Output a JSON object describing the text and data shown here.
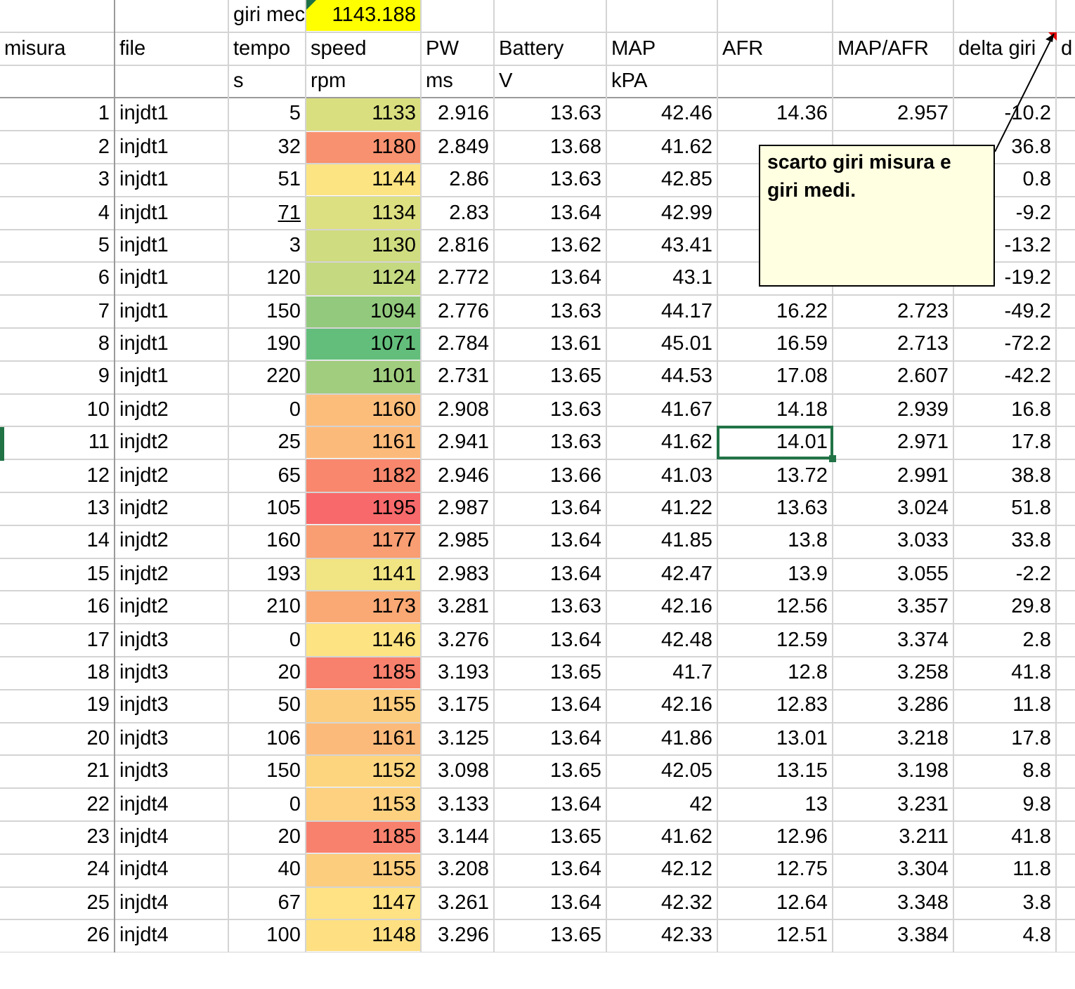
{
  "summary": {
    "label": "giri mec",
    "value": "1143.188"
  },
  "columns": [
    {
      "name": "misura"
    },
    {
      "name": "file"
    },
    {
      "name": "tempo",
      "unit": "s"
    },
    {
      "name": "speed",
      "unit": "rpm"
    },
    {
      "name": "PW",
      "unit": "ms"
    },
    {
      "name": "Battery",
      "unit": "V"
    },
    {
      "name": "MAP",
      "unit": "kPA"
    },
    {
      "name": "AFR"
    },
    {
      "name": "MAP/AFR"
    },
    {
      "name": "delta giri",
      "has_comment": true
    },
    {
      "name": "d"
    }
  ],
  "rows": [
    {
      "misura": "1",
      "file": "injdt1",
      "tempo": "5",
      "tempo_underlined": false,
      "speed": "1133",
      "color": "#d9df7f",
      "pw": "2.916",
      "battery": "13.63",
      "map": "42.46",
      "afr": "14.36",
      "afr_selected": false,
      "map_afr": "2.957",
      "delta": "-10.2"
    },
    {
      "misura": "2",
      "file": "injdt1",
      "tempo": "32",
      "tempo_underlined": false,
      "speed": "1180",
      "color": "#f8916f",
      "pw": "2.849",
      "battery": "13.68",
      "map": "41.62",
      "afr_selected": false,
      "delta": "36.8"
    },
    {
      "misura": "3",
      "file": "injdt1",
      "tempo": "51",
      "tempo_underlined": false,
      "speed": "1144",
      "color": "#fde482",
      "pw": "2.86",
      "battery": "13.63",
      "map": "42.85",
      "afr_selected": false,
      "delta": "0.8"
    },
    {
      "misura": "4",
      "file": "injdt1",
      "tempo": "71",
      "tempo_underlined": true,
      "speed": "1134",
      "color": "#dde081",
      "pw": "2.83",
      "battery": "13.64",
      "map": "42.99",
      "afr_selected": false,
      "delta": "-9.2"
    },
    {
      "misura": "5",
      "file": "injdt1",
      "tempo": "3",
      "tempo_underlined": false,
      "speed": "1130",
      "color": "#d0dc80",
      "pw": "2.816",
      "battery": "13.62",
      "map": "43.41",
      "afr_selected": false,
      "delta": "-13.2"
    },
    {
      "misura": "6",
      "file": "injdt1",
      "tempo": "120",
      "tempo_underlined": false,
      "speed": "1124",
      "color": "#c4d980",
      "pw": "2.772",
      "battery": "13.64",
      "map": "43.1",
      "afr_selected": false,
      "delta": "-19.2"
    },
    {
      "misura": "7",
      "file": "injdt1",
      "tempo": "150",
      "tempo_underlined": false,
      "speed": "1094",
      "color": "#92c97d",
      "pw": "2.776",
      "battery": "13.63",
      "map": "44.17",
      "afr": "16.22",
      "afr_selected": false,
      "map_afr": "2.723",
      "delta": "-49.2"
    },
    {
      "misura": "8",
      "file": "injdt1",
      "tempo": "190",
      "tempo_underlined": false,
      "speed": "1071",
      "color": "#63be7b",
      "pw": "2.784",
      "battery": "13.61",
      "map": "45.01",
      "afr": "16.59",
      "afr_selected": false,
      "map_afr": "2.713",
      "delta": "-72.2"
    },
    {
      "misura": "9",
      "file": "injdt1",
      "tempo": "220",
      "tempo_underlined": false,
      "speed": "1101",
      "color": "#a0cd7e",
      "pw": "2.731",
      "battery": "13.65",
      "map": "44.53",
      "afr": "17.08",
      "afr_selected": false,
      "map_afr": "2.607",
      "delta": "-42.2"
    },
    {
      "misura": "10",
      "file": "injdt2",
      "tempo": "0",
      "tempo_underlined": false,
      "speed": "1160",
      "color": "#fcbd7b",
      "pw": "2.908",
      "battery": "13.63",
      "map": "41.67",
      "afr": "14.18",
      "afr_selected": false,
      "map_afr": "2.939",
      "delta": "16.8"
    },
    {
      "misura": "11",
      "file": "injdt2",
      "tempo": "25",
      "tempo_underlined": false,
      "speed": "1161",
      "color": "#fcba7a",
      "pw": "2.941",
      "battery": "13.63",
      "map": "41.62",
      "afr": "14.01",
      "afr_selected": true,
      "map_afr": "2.971",
      "delta": "17.8"
    },
    {
      "misura": "12",
      "file": "injdt2",
      "tempo": "65",
      "tempo_underlined": false,
      "speed": "1182",
      "color": "#f8876d",
      "pw": "2.946",
      "battery": "13.66",
      "map": "41.03",
      "afr": "13.72",
      "afr_selected": false,
      "map_afr": "2.991",
      "delta": "38.8"
    },
    {
      "misura": "13",
      "file": "injdt2",
      "tempo": "105",
      "tempo_underlined": false,
      "speed": "1195",
      "color": "#f8696b",
      "pw": "2.987",
      "battery": "13.64",
      "map": "41.22",
      "afr": "13.63",
      "afr_selected": false,
      "map_afr": "3.024",
      "delta": "51.8"
    },
    {
      "misura": "14",
      "file": "injdt2",
      "tempo": "160",
      "tempo_underlined": false,
      "speed": "1177",
      "color": "#f99d72",
      "pw": "2.985",
      "battery": "13.64",
      "map": "41.85",
      "afr": "13.8",
      "afr_selected": false,
      "map_afr": "3.033",
      "delta": "33.8"
    },
    {
      "misura": "15",
      "file": "injdt2",
      "tempo": "193",
      "tempo_underlined": false,
      "speed": "1141",
      "color": "#f1e583",
      "pw": "2.983",
      "battery": "13.64",
      "map": "42.47",
      "afr": "13.9",
      "afr_selected": false,
      "map_afr": "3.055",
      "delta": "-2.2"
    },
    {
      "misura": "16",
      "file": "injdt2",
      "tempo": "210",
      "tempo_underlined": false,
      "speed": "1173",
      "color": "#faa874",
      "pw": "3.281",
      "battery": "13.63",
      "map": "42.16",
      "afr": "12.56",
      "afr_selected": false,
      "map_afr": "3.357",
      "delta": "29.8"
    },
    {
      "misura": "17",
      "file": "injdt3",
      "tempo": "0",
      "tempo_underlined": false,
      "speed": "1146",
      "color": "#fee382",
      "pw": "3.276",
      "battery": "13.64",
      "map": "42.48",
      "afr": "12.59",
      "afr_selected": false,
      "map_afr": "3.374",
      "delta": "2.8"
    },
    {
      "misura": "18",
      "file": "injdt3",
      "tempo": "20",
      "tempo_underlined": false,
      "speed": "1185",
      "color": "#f8816d",
      "pw": "3.193",
      "battery": "13.65",
      "map": "41.7",
      "afr": "12.8",
      "afr_selected": false,
      "map_afr": "3.258",
      "delta": "41.8"
    },
    {
      "misura": "19",
      "file": "injdt3",
      "tempo": "50",
      "tempo_underlined": false,
      "speed": "1155",
      "color": "#fdcd7e",
      "pw": "3.175",
      "battery": "13.64",
      "map": "42.16",
      "afr": "12.83",
      "afr_selected": false,
      "map_afr": "3.286",
      "delta": "11.8"
    },
    {
      "misura": "20",
      "file": "injdt3",
      "tempo": "106",
      "tempo_underlined": false,
      "speed": "1161",
      "color": "#fcba7a",
      "pw": "3.125",
      "battery": "13.64",
      "map": "41.86",
      "afr": "13.01",
      "afr_selected": false,
      "map_afr": "3.218",
      "delta": "17.8"
    },
    {
      "misura": "21",
      "file": "injdt3",
      "tempo": "150",
      "tempo_underlined": false,
      "speed": "1152",
      "color": "#fdd57f",
      "pw": "3.098",
      "battery": "13.65",
      "map": "42.05",
      "afr": "13.15",
      "afr_selected": false,
      "map_afr": "3.198",
      "delta": "8.8"
    },
    {
      "misura": "22",
      "file": "injdt4",
      "tempo": "0",
      "tempo_underlined": false,
      "speed": "1153",
      "color": "#fdd17f",
      "pw": "3.133",
      "battery": "13.64",
      "map": "42",
      "afr": "13",
      "afr_selected": false,
      "map_afr": "3.231",
      "delta": "9.8"
    },
    {
      "misura": "23",
      "file": "injdt4",
      "tempo": "20",
      "tempo_underlined": false,
      "speed": "1185",
      "color": "#f8816d",
      "pw": "3.144",
      "battery": "13.65",
      "map": "41.62",
      "afr": "12.96",
      "afr_selected": false,
      "map_afr": "3.211",
      "delta": "41.8"
    },
    {
      "misura": "24",
      "file": "injdt4",
      "tempo": "40",
      "tempo_underlined": false,
      "speed": "1155",
      "color": "#fdcd7e",
      "pw": "3.208",
      "battery": "13.64",
      "map": "42.12",
      "afr": "12.75",
      "afr_selected": false,
      "map_afr": "3.304",
      "delta": "11.8"
    },
    {
      "misura": "25",
      "file": "injdt4",
      "tempo": "67",
      "tempo_underlined": false,
      "speed": "1147",
      "color": "#ffe283",
      "pw": "3.261",
      "battery": "13.64",
      "map": "42.32",
      "afr": "12.64",
      "afr_selected": false,
      "map_afr": "3.348",
      "delta": "3.8"
    },
    {
      "misura": "26",
      "file": "injdt4",
      "tempo": "100",
      "tempo_underlined": false,
      "speed": "1148",
      "color": "#fee082",
      "pw": "3.296",
      "battery": "13.65",
      "map": "42.33",
      "afr": "12.51",
      "afr_selected": false,
      "map_afr": "3.384",
      "delta": "4.8"
    }
  ],
  "comment": {
    "text": "scarto giri misura e giri medi."
  }
}
